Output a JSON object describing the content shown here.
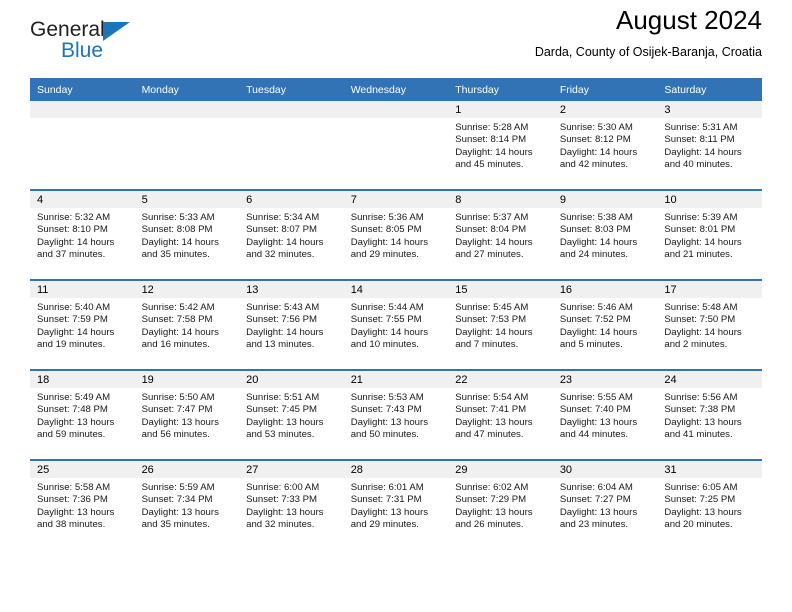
{
  "brand": {
    "name_part1": "General",
    "name_part2": "Blue",
    "accent_color": "#1b75bb"
  },
  "header": {
    "title": "August 2024",
    "subtitle": "Darda, County of Osijek-Baranja, Croatia"
  },
  "calendar": {
    "header_bg": "#3273b5",
    "daynum_bg": "#f0f0f0",
    "weekdays": [
      "Sunday",
      "Monday",
      "Tuesday",
      "Wednesday",
      "Thursday",
      "Friday",
      "Saturday"
    ],
    "weeks": [
      [
        {
          "day": "",
          "lines": []
        },
        {
          "day": "",
          "lines": []
        },
        {
          "day": "",
          "lines": []
        },
        {
          "day": "",
          "lines": []
        },
        {
          "day": "1",
          "lines": [
            "Sunrise: 5:28 AM",
            "Sunset: 8:14 PM",
            "Daylight: 14 hours",
            "and 45 minutes."
          ]
        },
        {
          "day": "2",
          "lines": [
            "Sunrise: 5:30 AM",
            "Sunset: 8:12 PM",
            "Daylight: 14 hours",
            "and 42 minutes."
          ]
        },
        {
          "day": "3",
          "lines": [
            "Sunrise: 5:31 AM",
            "Sunset: 8:11 PM",
            "Daylight: 14 hours",
            "and 40 minutes."
          ]
        }
      ],
      [
        {
          "day": "4",
          "lines": [
            "Sunrise: 5:32 AM",
            "Sunset: 8:10 PM",
            "Daylight: 14 hours",
            "and 37 minutes."
          ]
        },
        {
          "day": "5",
          "lines": [
            "Sunrise: 5:33 AM",
            "Sunset: 8:08 PM",
            "Daylight: 14 hours",
            "and 35 minutes."
          ]
        },
        {
          "day": "6",
          "lines": [
            "Sunrise: 5:34 AM",
            "Sunset: 8:07 PM",
            "Daylight: 14 hours",
            "and 32 minutes."
          ]
        },
        {
          "day": "7",
          "lines": [
            "Sunrise: 5:36 AM",
            "Sunset: 8:05 PM",
            "Daylight: 14 hours",
            "and 29 minutes."
          ]
        },
        {
          "day": "8",
          "lines": [
            "Sunrise: 5:37 AM",
            "Sunset: 8:04 PM",
            "Daylight: 14 hours",
            "and 27 minutes."
          ]
        },
        {
          "day": "9",
          "lines": [
            "Sunrise: 5:38 AM",
            "Sunset: 8:03 PM",
            "Daylight: 14 hours",
            "and 24 minutes."
          ]
        },
        {
          "day": "10",
          "lines": [
            "Sunrise: 5:39 AM",
            "Sunset: 8:01 PM",
            "Daylight: 14 hours",
            "and 21 minutes."
          ]
        }
      ],
      [
        {
          "day": "11",
          "lines": [
            "Sunrise: 5:40 AM",
            "Sunset: 7:59 PM",
            "Daylight: 14 hours",
            "and 19 minutes."
          ]
        },
        {
          "day": "12",
          "lines": [
            "Sunrise: 5:42 AM",
            "Sunset: 7:58 PM",
            "Daylight: 14 hours",
            "and 16 minutes."
          ]
        },
        {
          "day": "13",
          "lines": [
            "Sunrise: 5:43 AM",
            "Sunset: 7:56 PM",
            "Daylight: 14 hours",
            "and 13 minutes."
          ]
        },
        {
          "day": "14",
          "lines": [
            "Sunrise: 5:44 AM",
            "Sunset: 7:55 PM",
            "Daylight: 14 hours",
            "and 10 minutes."
          ]
        },
        {
          "day": "15",
          "lines": [
            "Sunrise: 5:45 AM",
            "Sunset: 7:53 PM",
            "Daylight: 14 hours",
            "and 7 minutes."
          ]
        },
        {
          "day": "16",
          "lines": [
            "Sunrise: 5:46 AM",
            "Sunset: 7:52 PM",
            "Daylight: 14 hours",
            "and 5 minutes."
          ]
        },
        {
          "day": "17",
          "lines": [
            "Sunrise: 5:48 AM",
            "Sunset: 7:50 PM",
            "Daylight: 14 hours",
            "and 2 minutes."
          ]
        }
      ],
      [
        {
          "day": "18",
          "lines": [
            "Sunrise: 5:49 AM",
            "Sunset: 7:48 PM",
            "Daylight: 13 hours",
            "and 59 minutes."
          ]
        },
        {
          "day": "19",
          "lines": [
            "Sunrise: 5:50 AM",
            "Sunset: 7:47 PM",
            "Daylight: 13 hours",
            "and 56 minutes."
          ]
        },
        {
          "day": "20",
          "lines": [
            "Sunrise: 5:51 AM",
            "Sunset: 7:45 PM",
            "Daylight: 13 hours",
            "and 53 minutes."
          ]
        },
        {
          "day": "21",
          "lines": [
            "Sunrise: 5:53 AM",
            "Sunset: 7:43 PM",
            "Daylight: 13 hours",
            "and 50 minutes."
          ]
        },
        {
          "day": "22",
          "lines": [
            "Sunrise: 5:54 AM",
            "Sunset: 7:41 PM",
            "Daylight: 13 hours",
            "and 47 minutes."
          ]
        },
        {
          "day": "23",
          "lines": [
            "Sunrise: 5:55 AM",
            "Sunset: 7:40 PM",
            "Daylight: 13 hours",
            "and 44 minutes."
          ]
        },
        {
          "day": "24",
          "lines": [
            "Sunrise: 5:56 AM",
            "Sunset: 7:38 PM",
            "Daylight: 13 hours",
            "and 41 minutes."
          ]
        }
      ],
      [
        {
          "day": "25",
          "lines": [
            "Sunrise: 5:58 AM",
            "Sunset: 7:36 PM",
            "Daylight: 13 hours",
            "and 38 minutes."
          ]
        },
        {
          "day": "26",
          "lines": [
            "Sunrise: 5:59 AM",
            "Sunset: 7:34 PM",
            "Daylight: 13 hours",
            "and 35 minutes."
          ]
        },
        {
          "day": "27",
          "lines": [
            "Sunrise: 6:00 AM",
            "Sunset: 7:33 PM",
            "Daylight: 13 hours",
            "and 32 minutes."
          ]
        },
        {
          "day": "28",
          "lines": [
            "Sunrise: 6:01 AM",
            "Sunset: 7:31 PM",
            "Daylight: 13 hours",
            "and 29 minutes."
          ]
        },
        {
          "day": "29",
          "lines": [
            "Sunrise: 6:02 AM",
            "Sunset: 7:29 PM",
            "Daylight: 13 hours",
            "and 26 minutes."
          ]
        },
        {
          "day": "30",
          "lines": [
            "Sunrise: 6:04 AM",
            "Sunset: 7:27 PM",
            "Daylight: 13 hours",
            "and 23 minutes."
          ]
        },
        {
          "day": "31",
          "lines": [
            "Sunrise: 6:05 AM",
            "Sunset: 7:25 PM",
            "Daylight: 13 hours",
            "and 20 minutes."
          ]
        }
      ]
    ]
  }
}
